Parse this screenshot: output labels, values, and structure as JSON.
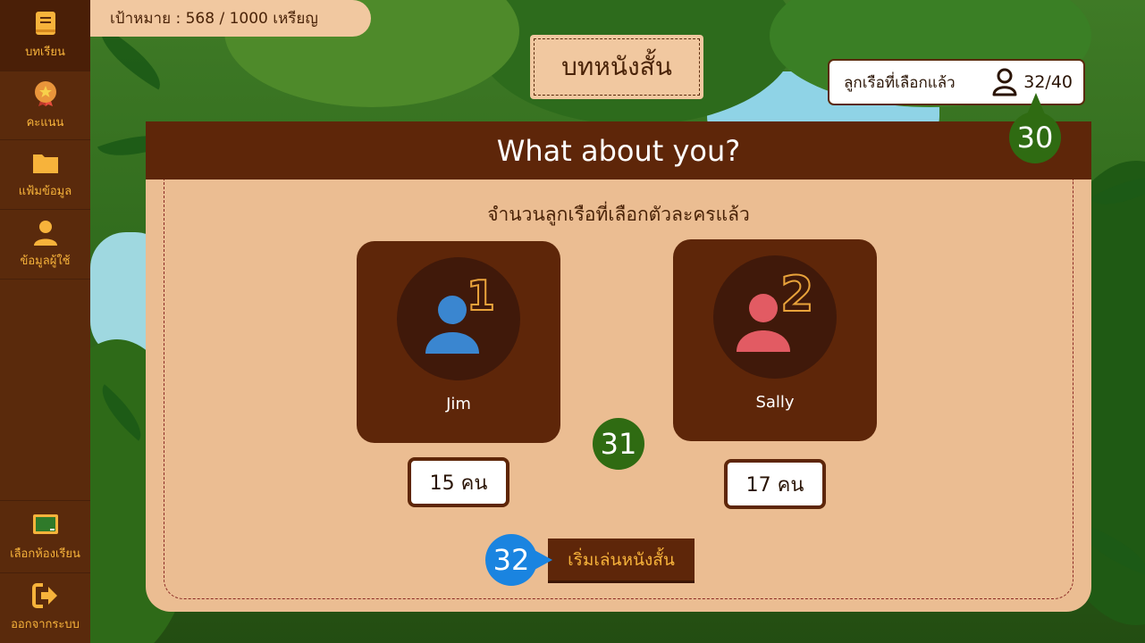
{
  "sidebar": {
    "items": [
      {
        "label": "บทเรียน",
        "icon": "book-icon",
        "active": true
      },
      {
        "label": "คะแนน",
        "icon": "medal-icon"
      },
      {
        "label": "แฟ้มข้อมูล",
        "icon": "folder-icon"
      },
      {
        "label": "ข้อมูลผู้ใช้",
        "icon": "user-icon"
      }
    ],
    "bottom_items": [
      {
        "label": "เลือกห้องเรียน",
        "icon": "chalkboard-icon"
      },
      {
        "label": "ออกจากระบบ",
        "icon": "logout-icon"
      }
    ]
  },
  "goal": {
    "text": "เป้าหมาย : 568 / 1000 เหรียญ"
  },
  "page_title": "บทหนังสั้น",
  "counter": {
    "label": "ลูกเรือที่เลือกแล้ว",
    "value": "32/40"
  },
  "panel": {
    "heading": "What about you?",
    "subtitle": "จำนวนลูกเรือที่เลือกตัวละครแล้ว",
    "characters": [
      {
        "number": "1",
        "name": "Jim",
        "count": "15 คน",
        "color": "#3a86d0"
      },
      {
        "number": "2",
        "name": "Sally",
        "count": "17 คน",
        "color": "#e25b63"
      }
    ],
    "start_button": "เริ่มเล่นหนังสั้น"
  },
  "markers": {
    "m30": "30",
    "m31": "31",
    "m32": "32"
  },
  "colors": {
    "sidebar": "#5a2a0c",
    "accent": "#f7b33b",
    "panel": "#ebbd92",
    "header": "#5e2609"
  }
}
